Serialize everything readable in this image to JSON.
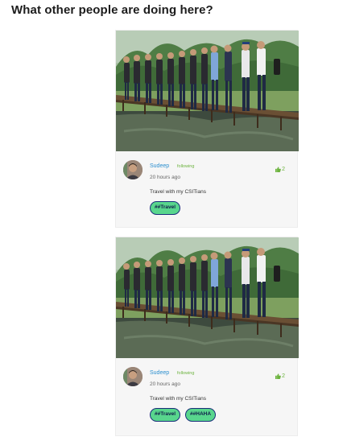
{
  "page": {
    "section_title": "What other people are doing here?"
  },
  "posts": [
    {
      "username": "Sudeep",
      "follow_status": "following",
      "time": "20 hours ago",
      "likes": "2",
      "caption": "Travel with my CSITians",
      "tags": [
        "##Travel"
      ]
    },
    {
      "username": "Sudeep",
      "follow_status": "following",
      "time": "20 hours ago",
      "likes": "2",
      "caption": "Travel with my CSITians",
      "tags": [
        "##Travel",
        "##HAHA"
      ]
    }
  ],
  "icons": {
    "like": "thumbs-up-icon"
  },
  "colors": {
    "username": "#2b8fcf",
    "follow": "#6cb33e",
    "likes": "#6cb33e",
    "tag_fill": "#58d68d",
    "tag_border": "#1a2f7a"
  }
}
